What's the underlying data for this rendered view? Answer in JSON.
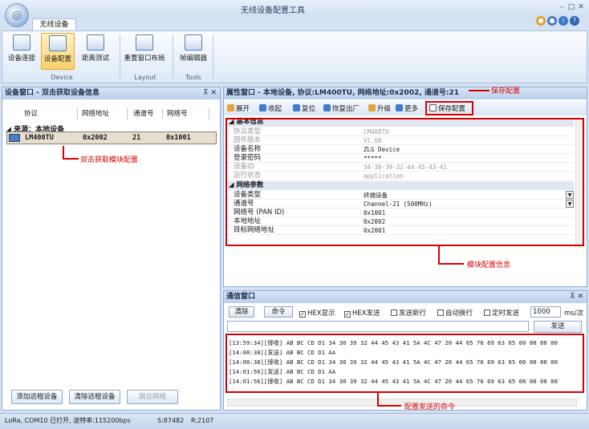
{
  "app": {
    "title": "无线设备配置工具",
    "tab": "无线设备"
  },
  "ribbon": {
    "device_connect": "设备连接",
    "device_config": "设备配置",
    "range_test": "距离测试",
    "reset_layout": "重置窗口布局",
    "frame_editor": "帧编辑器",
    "group_device": "Device",
    "group_layout": "Layout",
    "group_tools": "Tools"
  },
  "left_panel": {
    "title": "设备窗口 - 双击获取设备信息",
    "columns": [
      "协议",
      "网络地址",
      "通道号",
      "网络号"
    ],
    "group_label": "来源：本地设备",
    "row": {
      "protocol": "LM400TU",
      "address": "0x2002",
      "channel": "21",
      "net_id": "0x1001"
    },
    "annotation": "双击获取模块配置",
    "btn_add_remote": "添加远程设备",
    "btn_clear_remote": "清除远程设备",
    "btn_extra": "跳远网络"
  },
  "prop_panel": {
    "title": "属性窗口 - 本地设备, 协议:LM400TU, 网络地址:0x2002, 通道号:21",
    "toolbar": [
      "展开",
      "收起",
      "复位",
      "恢复出厂",
      "升级",
      "更多",
      "保存配置"
    ],
    "annotation_save": "保存配置",
    "annotation_module": "模块配置信息",
    "section_basic": "基本信息",
    "basic": [
      {
        "name": "协议类型",
        "value": "LM400TU",
        "muted": true
      },
      {
        "name": "固件版本",
        "value": "V1.08",
        "muted": true
      },
      {
        "name": "设备名称",
        "value": "ZLG Device",
        "muted": false
      },
      {
        "name": "登录密码",
        "value": "*****",
        "muted": false
      },
      {
        "name": "设备ID",
        "value": "34-30-39-32-44-45-43-41",
        "muted": true
      },
      {
        "name": "运行状态",
        "value": "application",
        "muted": true
      }
    ],
    "section_network": "网络参数",
    "network": [
      {
        "name": "设备类型",
        "value": "终端设备"
      },
      {
        "name": "通道号",
        "value": "Channel-21 (500MHz)"
      },
      {
        "name": "网络号 (PAN ID)",
        "value": "0x1001"
      },
      {
        "name": "本地地址",
        "value": "0x2002"
      },
      {
        "name": "目标网络地址",
        "value": "0x2001"
      }
    ]
  },
  "comm_panel": {
    "title": "通信窗口",
    "btn_clear": "清除",
    "btn_cmd": "命令",
    "chk_hex_show": "HEX显示",
    "chk_hex_send": "HEX发送",
    "chk_newline": "发送新行",
    "chk_auto": "自动换行",
    "chk_timer": "定时发送",
    "interval": "1000",
    "unit": "ms/次",
    "btn_send": "发送",
    "log": [
      "[13:59:34][接收] AB BC CD D1 34 30 39 32 44 45 43 41 5A 4C 47 20 44 65 76 69 63 65 00 00 00 00",
      "[14:00:38][发送] AB BC CD D1 AA",
      "[14:00:38][接收] AB BC CD D1 34 30 39 32 44 45 43 41 5A 4C 47 20 44 65 76 69 63 65 00 00 00 00",
      "[14:01:56][发送] AB BC CD D1 AA",
      "[14:01:56][接收] AB BC CD D1 34 30 39 32 44 45 43 41 5A 4C 47 20 44 65 76 69 63 65 00 00 00 00"
    ],
    "annotation": "配置发送的命令"
  },
  "status": {
    "text": "LoRa, COM10 已打开, 波特率:115200bps",
    "s": "S:87482",
    "r": "R:2107"
  }
}
